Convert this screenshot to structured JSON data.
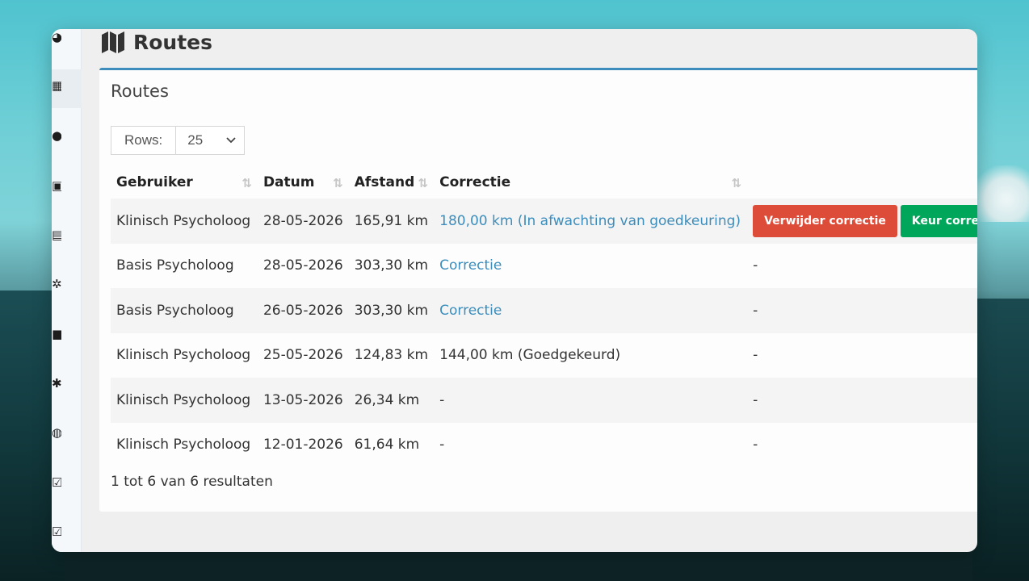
{
  "page": {
    "title": "Routes"
  },
  "card": {
    "title": "Routes"
  },
  "rows_control": {
    "label": "Rows:",
    "selected": "25"
  },
  "table": {
    "headers": [
      "Gebruiker",
      "Datum",
      "Afstand",
      "Correctie"
    ],
    "rows": [
      {
        "user": "Klinisch Psycholoog",
        "date": "28-05-2026",
        "distance": "165,91 km",
        "correction": "180,00 km (In afwachting van goedkeuring)",
        "correction_link": true,
        "actions": [
          "Verwijder correctie",
          "Keur corre"
        ]
      },
      {
        "user": "Basis Psycholoog",
        "date": "28-05-2026",
        "distance": "303,30 km",
        "correction": "Correctie",
        "correction_link": true,
        "actions_text": "-"
      },
      {
        "user": "Basis Psycholoog",
        "date": "26-05-2026",
        "distance": "303,30 km",
        "correction": "Correctie",
        "correction_link": true,
        "actions_text": "-"
      },
      {
        "user": "Klinisch Psycholoog",
        "date": "25-05-2026",
        "distance": "124,83 km",
        "correction": "144,00 km (Goedgekeurd)",
        "correction_link": false,
        "actions_text": "-"
      },
      {
        "user": "Klinisch Psycholoog",
        "date": "13-05-2026",
        "distance": "26,34 km",
        "correction": "-",
        "correction_link": false,
        "actions_text": "-"
      },
      {
        "user": "Klinisch Psycholoog",
        "date": "12-01-2026",
        "distance": "61,64 km",
        "correction": "-",
        "correction_link": false,
        "actions_text": "-"
      }
    ]
  },
  "result_info": "1 tot 6 van 6 resultaten",
  "colors": {
    "accent": "#3c8dbc",
    "danger": "#dd4b39",
    "success": "#00a65a"
  },
  "sidebar_icons": [
    "dashboard-icon",
    "calendar-icon",
    "users-icon",
    "id-card-icon",
    "book-icon",
    "cogs-icon",
    "truck-icon",
    "gear-icon",
    "globe-icon",
    "checkbox-icon",
    "checkbox-icon"
  ]
}
